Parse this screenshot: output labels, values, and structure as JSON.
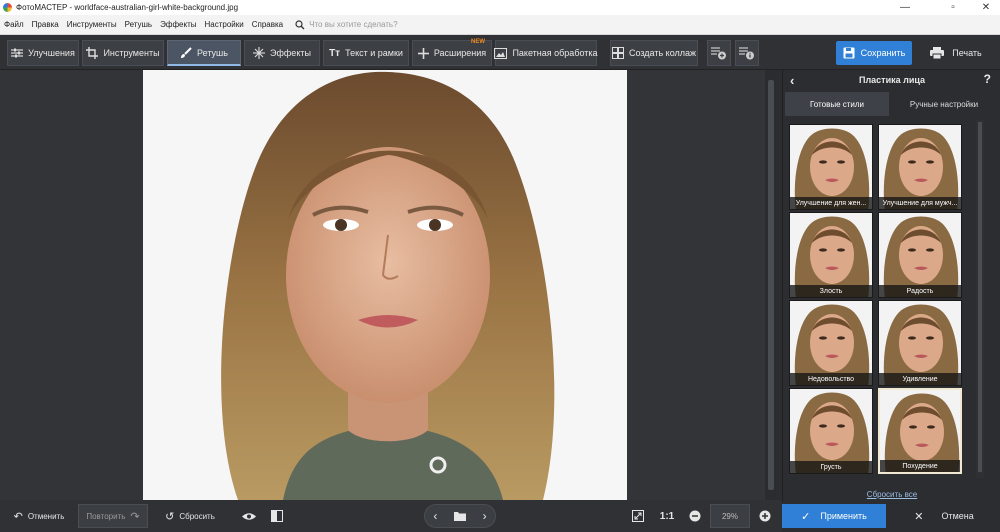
{
  "window": {
    "title": "ФотоМАСТЕР - worldface-australian-girl-white-background.jpg"
  },
  "menu": {
    "items": [
      "Файл",
      "Правка",
      "Инструменты",
      "Ретушь",
      "Эффекты",
      "Настройки",
      "Справка"
    ],
    "search_placeholder": "Что вы хотите сделать?"
  },
  "toolbar": {
    "tabs": [
      {
        "label": "Улучшения",
        "icon": "sliders-icon"
      },
      {
        "label": "Инструменты",
        "icon": "crop-icon"
      },
      {
        "label": "Ретушь",
        "icon": "brush-icon",
        "active": true
      },
      {
        "label": "Эффекты",
        "icon": "sparkle-icon"
      },
      {
        "label": "Текст и рамки",
        "icon": "text-icon"
      },
      {
        "label": "Расширения",
        "icon": "plus-icon",
        "badge": "NEW"
      },
      {
        "label": "Пакетная обработка",
        "icon": "image-stack-icon"
      },
      {
        "label": "Создать коллаж",
        "icon": "collage-icon"
      }
    ],
    "save_label": "Сохранить",
    "print_label": "Печать"
  },
  "panel": {
    "title": "Пластика лица",
    "help": "?",
    "tabs": [
      {
        "label": "Готовые стили",
        "selected": true
      },
      {
        "label": "Ручные настройки",
        "selected": false
      }
    ],
    "presets": [
      {
        "label": "Улучшение для жен..."
      },
      {
        "label": "Улучшение для мужч..."
      },
      {
        "label": "Злость"
      },
      {
        "label": "Радость"
      },
      {
        "label": "Недовольство"
      },
      {
        "label": "Удивление"
      },
      {
        "label": "Грусть"
      },
      {
        "label": "Похудение",
        "selected": true
      }
    ],
    "reset_all": "Сбросить все",
    "apply_label": "Применить",
    "cancel_label": "Отмена"
  },
  "bottom": {
    "undo": "Отменить",
    "redo": "Повторить",
    "reset": "Сбросить",
    "ratio": "1:1",
    "zoom": "29%"
  },
  "colors": {
    "accent": "#2f80d6",
    "badge": "#f08a24",
    "selected_border": "#f1e9d2"
  }
}
